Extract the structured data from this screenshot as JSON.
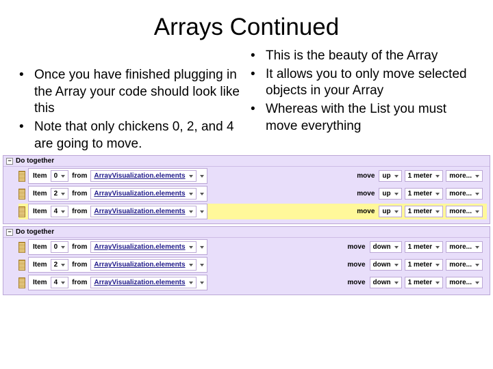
{
  "title": "Arrays Continued",
  "left_bullets": [
    "Once you have finished plugging in the Array your code should look like this",
    "Note that only chickens 0, 2, and 4 are going to move."
  ],
  "right_bullets": [
    "This is the beauty of the Array",
    "It allows you to only move selected objects in your Array",
    "Whereas with the List you must move everything"
  ],
  "bullet_symbol": "•",
  "do_together_label": "Do together",
  "minus_symbol": "−",
  "labels": {
    "item": "Item",
    "from": "from",
    "array_ref": "ArrayVisualization.elements",
    "move": "move",
    "one_meter": "1 meter",
    "more": "more..."
  },
  "blocks": [
    {
      "direction": "up",
      "rows": [
        {
          "index": "0",
          "highlight": false
        },
        {
          "index": "2",
          "highlight": false
        },
        {
          "index": "4",
          "highlight": true
        }
      ]
    },
    {
      "direction": "down",
      "rows": [
        {
          "index": "0",
          "highlight": false
        },
        {
          "index": "2",
          "highlight": false
        },
        {
          "index": "4",
          "highlight": false
        }
      ]
    }
  ]
}
